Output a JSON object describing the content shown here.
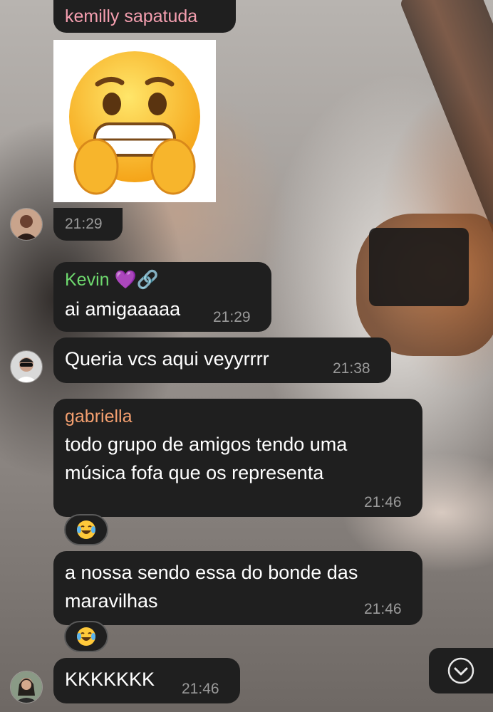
{
  "messages": [
    {
      "sender": "kemilly sapatuda",
      "sender_color": "#f59fb0",
      "type": "sticker",
      "sticker_icon": "anxious-grimacing-face",
      "time": "21:29"
    },
    {
      "sender": "Kevin",
      "sender_emojis": "💜🔗",
      "sender_color": "#6ed96e",
      "text": "ai amigaaaaa",
      "time": "21:29"
    },
    {
      "text": "Queria vcs aqui veyyrrrr",
      "time": "21:38"
    },
    {
      "sender": "gabriella",
      "sender_color": "#f5a070",
      "text_line1": "todo grupo de amigos tendo uma",
      "text_line2": "música fofa que os representa",
      "time": "21:46",
      "reaction_icon": "laughing-tears-emoji"
    },
    {
      "text_line1": "a nossa sendo essa do bonde das",
      "text_line2": "maravilhas",
      "time": "21:46",
      "reaction_icon": "laughing-tears-emoji"
    },
    {
      "text": "KKKKKKK",
      "time": "21:46"
    }
  ],
  "scroll_button": {
    "icon": "chevron-down-circle-icon"
  },
  "colors": {
    "bubble": "#1f1f1f",
    "time": "#9a9a9a"
  }
}
